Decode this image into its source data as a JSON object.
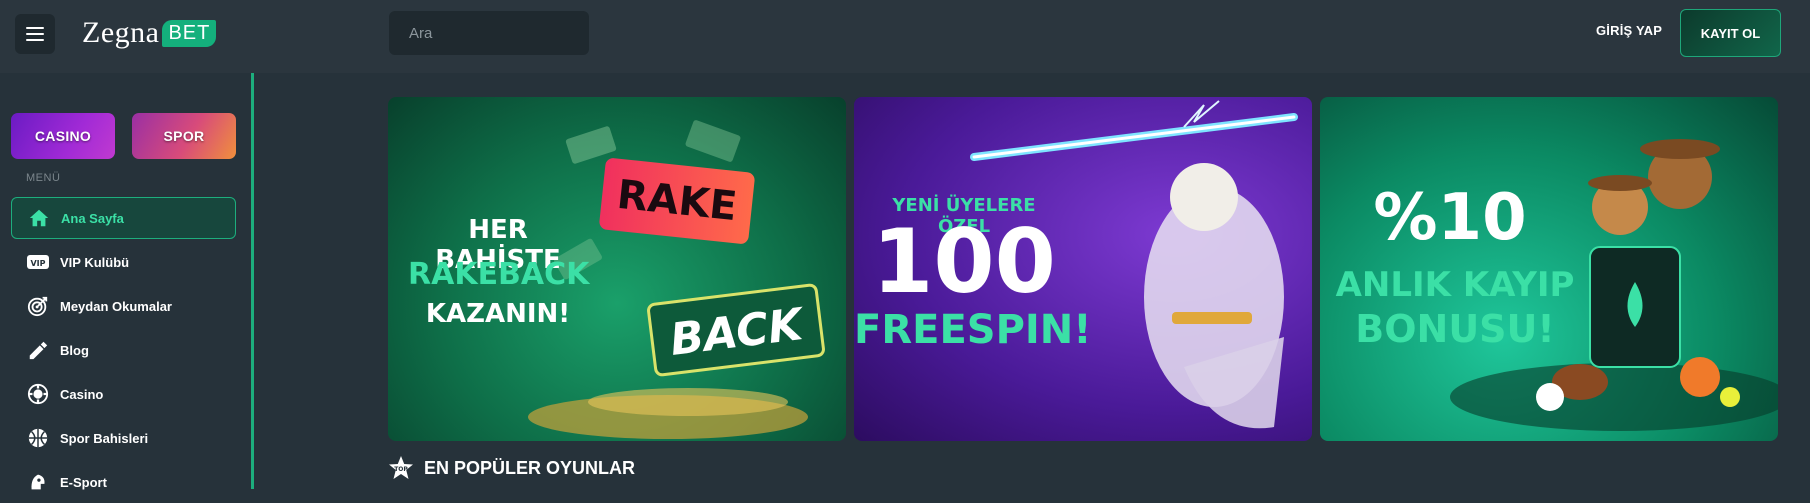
{
  "header": {
    "logo_main": "Zegna",
    "logo_badge": "BET",
    "search_placeholder": "Ara",
    "login_label": "GİRİŞ YAP",
    "register_label": "KAYIT OL"
  },
  "sidebar": {
    "chips": [
      {
        "label": "CASINO"
      },
      {
        "label": "SPOR"
      }
    ],
    "menu_title": "MENÜ",
    "items": [
      {
        "label": "Ana Sayfa",
        "icon": "home-icon",
        "active": true
      },
      {
        "label": "VIP Kulübü",
        "icon": "vip-icon"
      },
      {
        "label": "Meydan Okumalar",
        "icon": "target-icon"
      },
      {
        "label": "Blog",
        "icon": "blog-icon"
      },
      {
        "label": "Casino",
        "icon": "casino-chip-icon"
      },
      {
        "label": "Spor Bahisleri",
        "icon": "basketball-icon"
      },
      {
        "label": "E-Sport",
        "icon": "esport-icon"
      }
    ]
  },
  "banners": [
    {
      "line1": "HER BAHİSTE",
      "line2": "RAKEBACK",
      "line3": "KAZANIN!",
      "badge_top": "RAKE",
      "badge_bottom": "BACK"
    },
    {
      "line1": "YENİ ÜYELERE ÖZEL",
      "line2": "100",
      "line3": "FREESPIN!"
    },
    {
      "line1": "%10",
      "line2": "ANLIK KAYIP",
      "line3": "BONUSU!"
    }
  ],
  "section": {
    "popular_title": "EN POPÜLER OYUNLAR",
    "top_badge": "TOP"
  },
  "colors": {
    "accent": "#1dae7d",
    "background": "#26323a",
    "header": "#2b363e"
  }
}
